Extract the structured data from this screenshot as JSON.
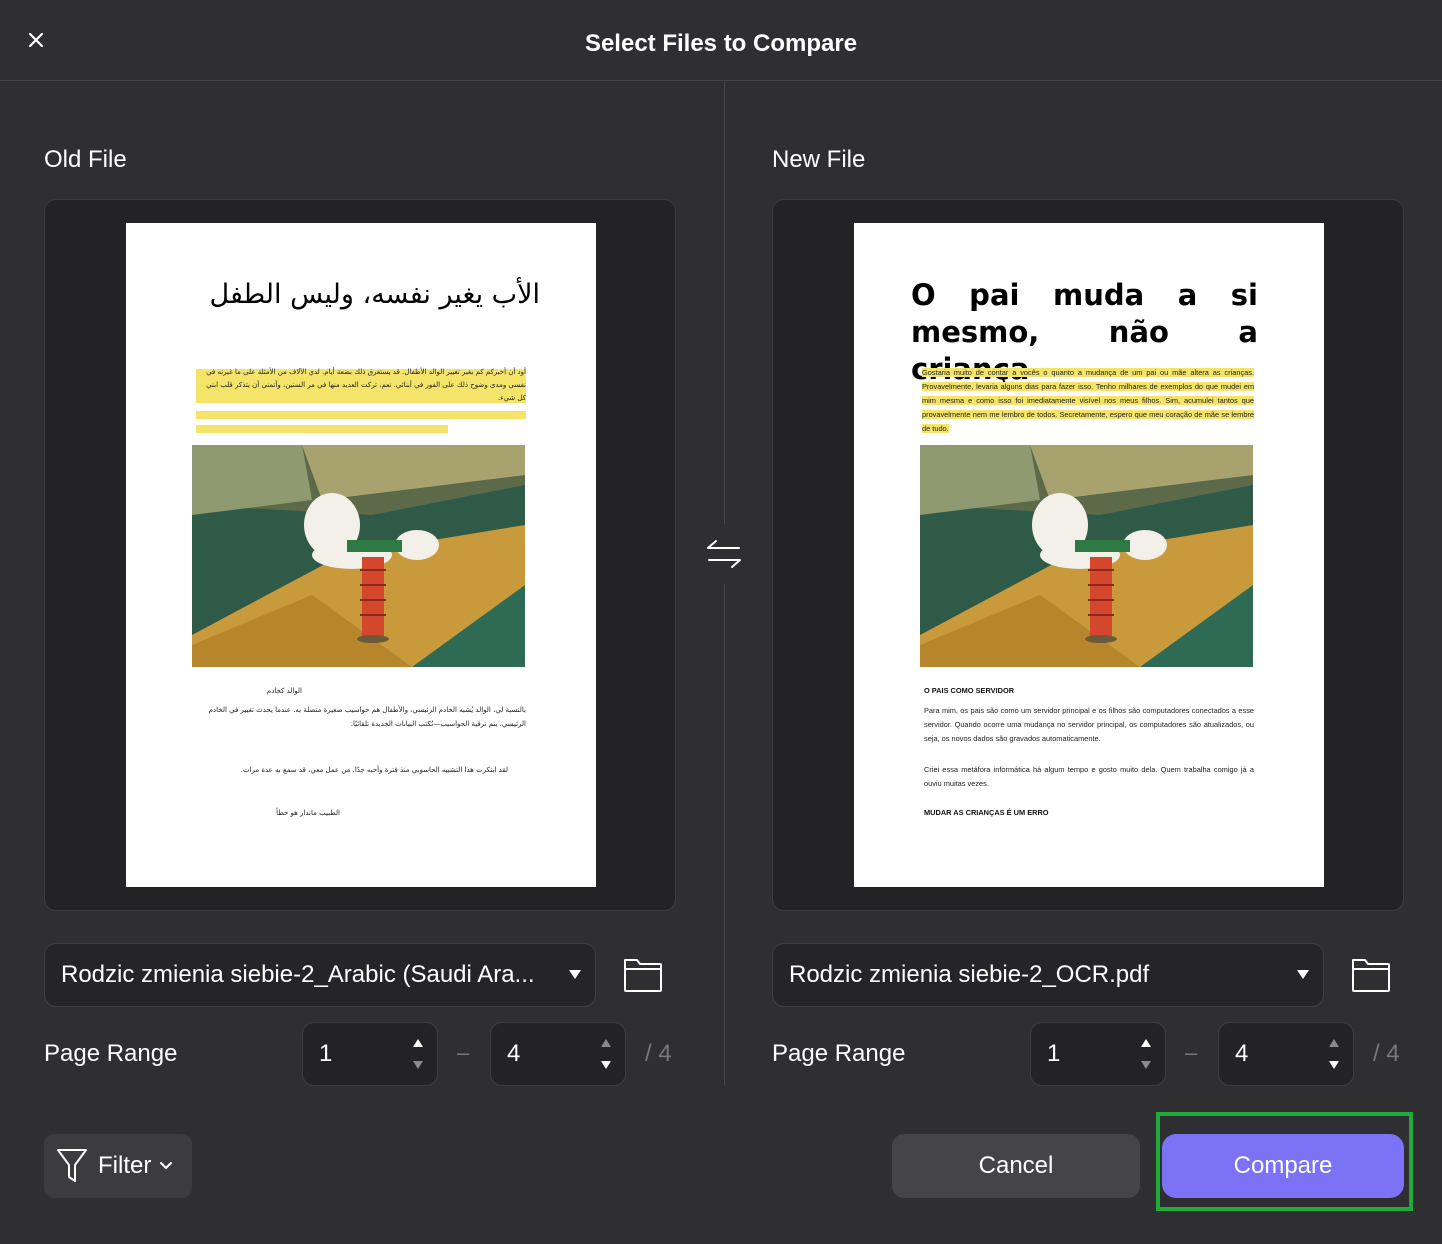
{
  "dialog": {
    "title": "Select Files to Compare"
  },
  "swap": {
    "icon": "swap-arrows-icon"
  },
  "old_file": {
    "heading": "Old File",
    "file_name": "Rodzic zmienia siebie-2_Arabic (Saudi Ara...",
    "range_label": "Page Range",
    "range_from": "1",
    "range_to": "4",
    "range_sep": "–",
    "total": "/ 4",
    "preview": {
      "title": "الأب يغير نفسه، وليس الطفل",
      "para1": "أود أن أخبركم كم يغير تغيير الوالد الأطفال. قد يستغرق ذلك بضعة أيام. لدي الآلاف من الأمثلة على ما غيرته في نفسي ومدى وضوح ذلك على الفور في أبنائي. نعم، تركت العديد منها في مر السنين، وأتمنى أن يتذكر قلب ابني كل شيء.",
      "subhead": "الوالد كخادم",
      "para2": "بالنسبة لي، الوالد يُشبه الخادم الرئيسي، والأطفال هم حواسيب صغيرة متصلة به. عندما يحدث تغيير في الخادم الرئيسي، يتم ترقية الحواسيب—تُكتب البيانات الجديدة تلقائيًا.",
      "para3": "لقد ابتكرت هذا التشبيه الحاسوبي منذ فترة وأحبه جدًا. من عمل معي، قد سمع به عدة مرات.",
      "para4": "الطبيب ماندار هو خطأ"
    }
  },
  "new_file": {
    "heading": "New File",
    "file_name": "Rodzic zmienia siebie-2_OCR.pdf",
    "range_label": "Page Range",
    "range_from": "1",
    "range_to": "4",
    "range_sep": "–",
    "total": "/ 4",
    "preview": {
      "title": "O pai muda a si mesmo, não a criança",
      "para1": "Gostaria muito de contar a vocês o quanto a mudança de um pai ou mãe altera as crianças. Provavelmente, levaria alguns dias para fazer isso. Tenho milhares de exemplos do que mudei em mim mesma e como isso foi imediatamente visível nos meus filhos. Sim, acumulei tantos que provavelmente nem me lembro de todos. Secretamente, espero que meu coração de mãe se lembre de tudo.",
      "subhead": "O PAIS COMO SERVIDOR",
      "para2": "Para mim, os pais são como um servidor principal e os filhos são computadores conectados a esse servidor. Quando ocorre uma mudança no servidor principal, os computadores são atualizados, ou seja, os novos dados são gravados automaticamente.",
      "para3": "Criei essa metáfora informática há algum tempo e gosto muito dela. Quem trabalha comigo já a ouviu muitas vezes.",
      "subhead2": "MUDAR AS CRIANÇAS É UM ERRO"
    }
  },
  "footer": {
    "filter_label": "Filter",
    "cancel_label": "Cancel",
    "compare_label": "Compare"
  },
  "colors": {
    "background": "#2f2f31",
    "accent": "#7b72f5",
    "highlight": "#f5e46a",
    "focus_outline": "#1faa3c"
  }
}
